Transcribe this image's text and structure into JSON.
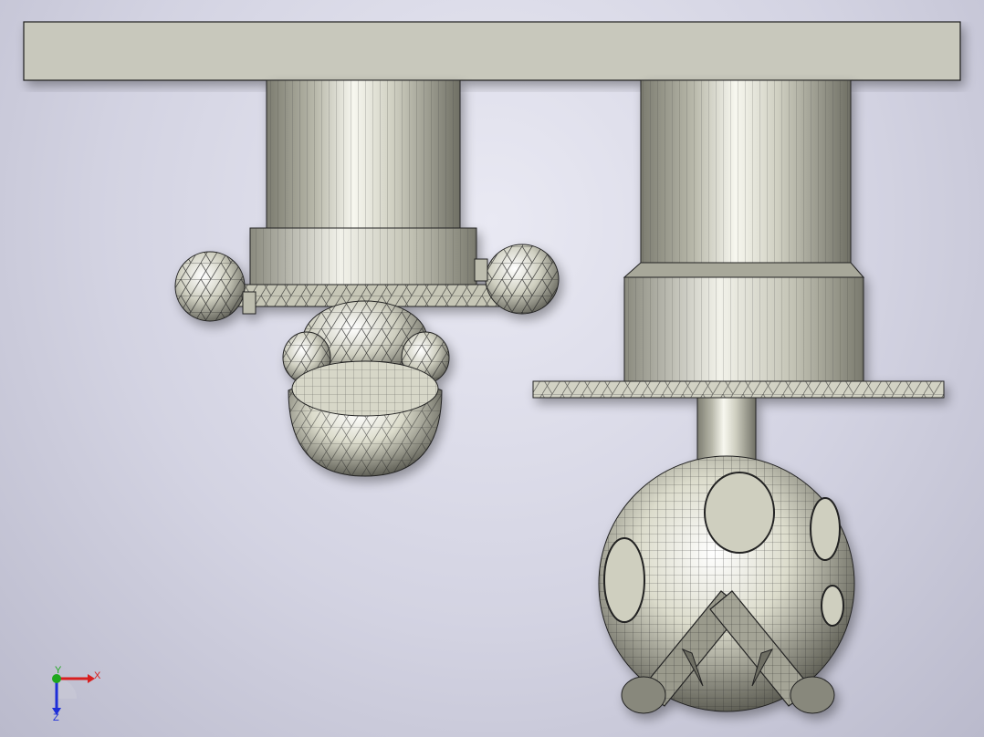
{
  "viewport": {
    "background_top": "#e9e9f3",
    "background_bottom": "#babacc"
  },
  "model": {
    "plate_color": "#c8c8bc",
    "metal_color": "#d8d8c8",
    "edge_color": "#2a2a2a"
  },
  "triad": {
    "x_label": "X",
    "y_label": "Y",
    "z_label": "Z",
    "x_color": "#d81e1e",
    "y_color": "#1ea81e",
    "z_color": "#1e2ed8"
  }
}
